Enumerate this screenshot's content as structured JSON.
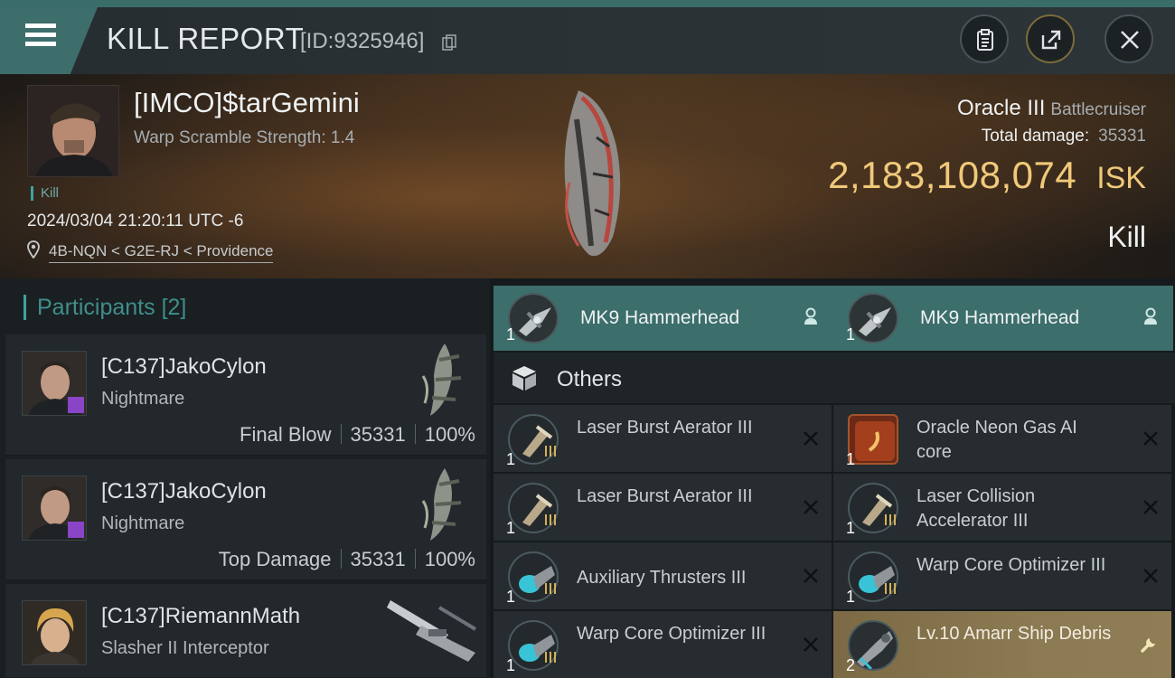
{
  "header": {
    "title": "KILL REPORT",
    "report_id": "[ID:9325946]",
    "icons": {
      "menu": "hamburger-menu-icon",
      "copy": "copy-icon",
      "clipboard": "clipboard-icon",
      "share": "share-icon",
      "close": "close-icon"
    }
  },
  "victim": {
    "name": "[IMCO]$tarGemini",
    "warp_scramble": "Warp Scramble Strength: 1.4",
    "tag": "Kill",
    "datetime": "2024/03/04 21:20:11 UTC -6",
    "location": "4B-NQN < G2E-RJ < Providence",
    "ship_name": "Oracle III",
    "ship_class": "Battlecruiser",
    "total_damage_label": "Total damage:",
    "total_damage": "35331",
    "isk_value": "2,183,108,074",
    "isk_unit": "ISK",
    "result": "Kill",
    "colors": {
      "isk": "#f0c97a",
      "accent": "#3fa39e"
    }
  },
  "participants": {
    "title": "Participants",
    "count": "[2]",
    "rows": [
      {
        "name": "[C137]JakoCylon",
        "ship": "Nightmare",
        "role": "Final Blow",
        "damage": "35331",
        "percent": "100%"
      },
      {
        "name": "[C137]JakoCylon",
        "ship": "Nightmare",
        "role": "Top Damage",
        "damage": "35331",
        "percent": "100%"
      },
      {
        "name": "[C137]RiemannMath",
        "ship": "Slasher II Interceptor"
      }
    ]
  },
  "drones": [
    {
      "name": "MK9  Hammerhead",
      "qty": "1"
    },
    {
      "name": "MK9  Hammerhead",
      "qty": "1"
    }
  ],
  "others": {
    "label": "Others",
    "items": [
      {
        "name": "Laser Burst Aerator III",
        "qty": "1"
      },
      {
        "name": "Oracle Neon Gas AI core",
        "qty": "1"
      },
      {
        "name": "Laser Burst Aerator III",
        "qty": "1"
      },
      {
        "name": "Laser Collision Accelerator III",
        "qty": "1"
      },
      {
        "name": "Auxiliary Thrusters III",
        "qty": "1"
      },
      {
        "name": "Warp Core Optimizer III",
        "qty": "1"
      },
      {
        "name": "Warp Core Optimizer III",
        "qty": "1"
      },
      {
        "name": "Lv.10 Amarr Ship Debris",
        "qty": "2"
      }
    ]
  }
}
